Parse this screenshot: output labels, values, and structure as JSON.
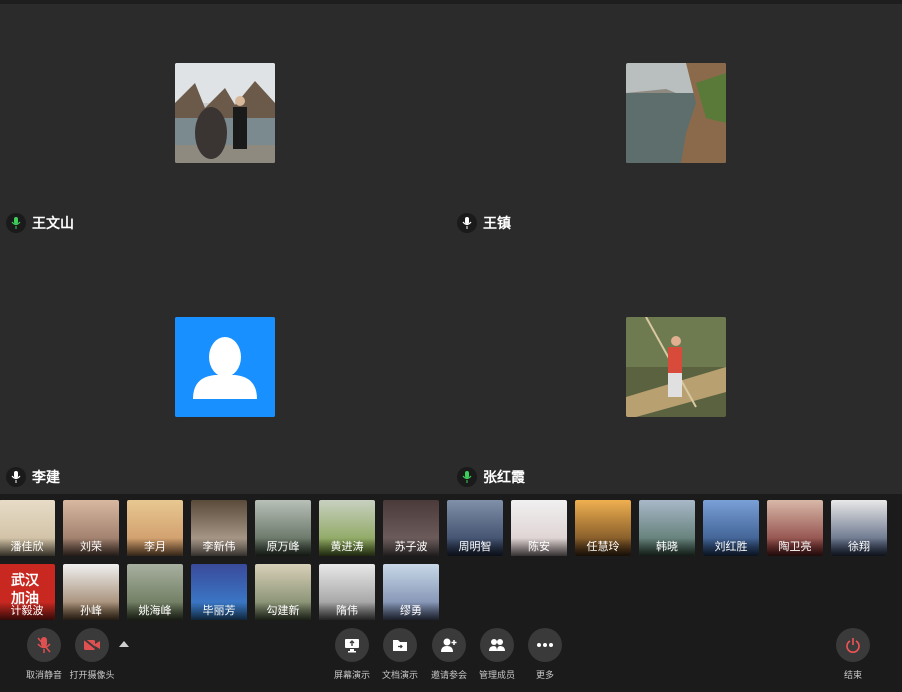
{
  "main_participants": [
    {
      "name": "王文山",
      "photo": "lake-man-photo"
    },
    {
      "name": "王镇",
      "photo": "river-cliff-photo"
    },
    {
      "name": "李建",
      "photo": "default-avatar"
    },
    {
      "name": "张红霞",
      "photo": "bamboo-raft-photo"
    }
  ],
  "thumbnails_row1": [
    "潘佳欣",
    "刘荣",
    "李月",
    "李新伟",
    "原万峰",
    "黄进涛",
    "苏子波",
    "周明智",
    "陈安",
    "任慧玲",
    "韩晓",
    "刘红胜",
    "陶卫亮",
    "徐翔"
  ],
  "thumbnails_row2": [
    "计毅波",
    "孙峰",
    "姚海峰",
    "毕丽芳",
    "勾建新",
    "隋伟",
    "缪勇"
  ],
  "toolbar": {
    "unmute": "取消静音",
    "camera": "打开摄像头",
    "screen_share": "屏幕演示",
    "doc_share": "文档演示",
    "invite": "邀请参会",
    "manage": "管理成员",
    "more": "更多",
    "end": "结束"
  },
  "colors": {
    "accent_blue": "#1890ff",
    "mic_green": "#3ccf5a",
    "end_red": "#f05454",
    "muted_red": "#e05050"
  }
}
